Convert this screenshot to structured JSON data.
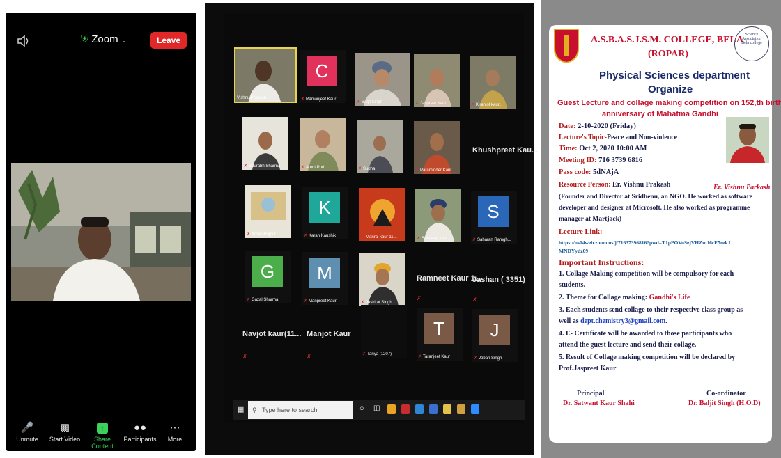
{
  "zoom_mobile": {
    "meeting_title": "Zoom",
    "leave_label": "Leave",
    "toolbar": {
      "unmute": "Unmute",
      "start_video": "Start Video",
      "share_content": "Share Content",
      "participants": "Participants",
      "more": "More"
    },
    "colors": {
      "leave": "#e02828",
      "share": "#3bd15b"
    }
  },
  "gallery": {
    "participants": [
      {
        "name": "Vishnu Prakash"
      },
      {
        "name": "Ramanjeet Kaur",
        "letter": "C",
        "color": "#e0325a"
      },
      {
        "name": "Baljit Singh"
      },
      {
        "name": "Jaspreet Kaur"
      },
      {
        "name": "Kiranjot kaur..."
      },
      {
        "name": "Saurabh Sharma"
      },
      {
        "name": "Amrit Puri"
      },
      {
        "name": "Sudha"
      },
      {
        "name": "Paraminder Kaur"
      },
      {
        "name": "Khushpreet Kau..."
      },
      {
        "name": "Aman Rajput"
      },
      {
        "name": "Karan Kaushik",
        "letter": "K",
        "color": "#1fa79a"
      },
      {
        "name": "Manraj kaur 11..."
      },
      {
        "name": "Sandeep kaur ..."
      },
      {
        "name": "Saharan Ramgh...",
        "letter": "S",
        "color": "#2b67b8"
      },
      {
        "name": "Gazal Sharma",
        "letter": "G",
        "color": "#4cae4a"
      },
      {
        "name": "Manpreet Kaur",
        "letter": "M",
        "color": "#5f8fb0"
      },
      {
        "name": "Jaskirat Singh"
      },
      {
        "name": "Ramneet Kaur 1..."
      },
      {
        "name": "Jashan ( 3351)"
      },
      {
        "name": "Navjot  kaur(11..."
      },
      {
        "name": "Manjot Kaur"
      },
      {
        "name": "Tanya (1207)"
      },
      {
        "name": "Taranjeet Kaur",
        "letter": "T",
        "color": "#7a5a46"
      },
      {
        "name": "Joban Singh",
        "letter": "J",
        "color": "#7a5a46"
      }
    ],
    "taskbar_search_placeholder": "Type here to search"
  },
  "poster": {
    "college": "A.S.B.A.S.J.S.M. COLLEGE, BELA",
    "location": "(ROPAR)",
    "seal_text": "Science Association",
    "seal_subtext": "Bela college",
    "department": "Physical Sciences department",
    "organize": "Organize",
    "event_line1": "Guest Lecture and collage making competition on 152,th birth",
    "event_line2": "anniversary of Mahatma Gandhi",
    "date_label": "Date:",
    "date_value": "2-10-2020 (Friday)",
    "topic_label": "Lecture's Topic-",
    "topic_value": "Peace and Non-violence",
    "time_label": "Time:",
    "time_value": "Oct 2, 2020 10:00 AM",
    "meeting_label": "Meeting ID:",
    "meeting_value": "716 3739 6816",
    "pass_label": "Pass code:",
    "pass_value": "5dNAjA",
    "speaker_caption": "Er. Vishnu Parkash",
    "resource_label": "Resource Person:",
    "resource_value": "Er. Vishnu Prakash",
    "bio_line1": "(Founder and Director at Sridhenu, an NGO. He worked as software",
    "bio_line2": "developer and designer at Microsoft. He also worked as programme",
    "bio_line3": "manager at Martjack)",
    "link_label": "Lecture Link:",
    "link_line1": "https://us04web.zoom.us/j/71637396816?pwd=T1pPOVoSejVHZmJ6cE5rekJ",
    "link_line2": "MNDYydz09",
    "instructions_title": "Important Instructions:",
    "instr1_a": "1.  Collage Making competition will be compulsory for each",
    "instr1_b": "     students.",
    "instr2_a": "2.  Theme for Collage making:",
    "instr2_b": "Gandhi's Life",
    "instr3_a": "3.  Each students send collage to their respective class group as",
    "instr3_b": "     well as",
    "instr3_email": "dept.chemistry3@gmail.com",
    "instr3_c": ".",
    "instr4_a": "4.   E- Certificate will be awarded to those participants who",
    "instr4_b": "     attend the guest lecture and send their collage.",
    "instr5_a": "5.  Result of Collage making competition will be declared by",
    "instr5_b": "     Prof.Jaspreet Kaur",
    "principal_label": "Principal",
    "principal_name": "Dr. Satwant Kaur Shahi",
    "coordinator_label": "Co-ordinator",
    "coordinator_name": "Dr. Baljit Singh (H.O.D)",
    "colors": {
      "title_red": "#c8102e",
      "dept_navy": "#1b2a6b",
      "label_red": "#b31b1b",
      "body_navy": "#1a1d4a"
    }
  }
}
